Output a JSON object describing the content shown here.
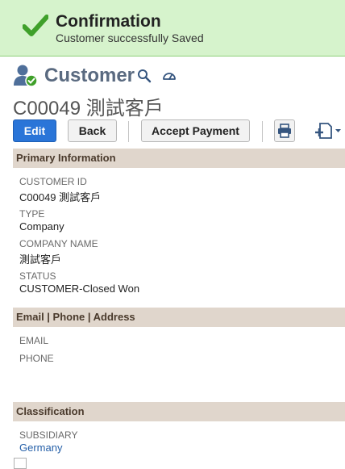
{
  "confirmation": {
    "title": "Confirmation",
    "message": "Customer successfully Saved",
    "icon": "checkmark-icon",
    "accent": "#3fa02a"
  },
  "header": {
    "record_type": "Customer",
    "record_name": "C00049 測試客戶",
    "icons": [
      "customer-icon",
      "search-icon",
      "dashboard-gauge-icon"
    ]
  },
  "toolbar": {
    "edit_label": "Edit",
    "back_label": "Back",
    "accept_payment_label": "Accept Payment",
    "print_icon": "print-icon",
    "new_icon": "new-record-icon"
  },
  "sections": {
    "primary": {
      "title": "Primary Information",
      "fields": [
        {
          "label": "CUSTOMER ID",
          "value": "C00049 測試客戶"
        },
        {
          "label": "TYPE",
          "value": "Company"
        },
        {
          "label": "COMPANY NAME",
          "value": "測試客戶"
        },
        {
          "label": "STATUS",
          "value": "CUSTOMER-Closed Won"
        }
      ]
    },
    "contact": {
      "title": "Email | Phone | Address",
      "fields": [
        {
          "label": "EMAIL",
          "value": ""
        },
        {
          "label": "PHONE",
          "value": ""
        }
      ]
    },
    "classification": {
      "title": "Classification",
      "fields": [
        {
          "label": "SUBSIDIARY",
          "value": "Germany"
        }
      ]
    }
  },
  "colors": {
    "confirm_bg": "#d6f3cc",
    "primary_button": "#2a75d8",
    "section_bar": "#e0d6cc",
    "link": "#255fa8"
  }
}
